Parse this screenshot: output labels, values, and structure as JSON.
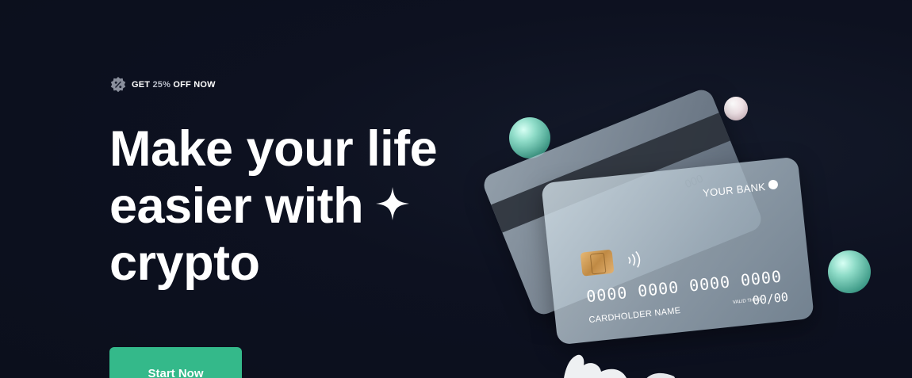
{
  "badge": {
    "icon": "percent-badge-icon",
    "prefix": "GET ",
    "percent": "25%",
    "suffix": " OFF NOW"
  },
  "hero": {
    "title_line1": "Make your life",
    "title_line2": "easier with",
    "title_line3": "crypto",
    "sparkle_icon": "sparkle-icon",
    "cta_label": "Start Now"
  },
  "card": {
    "bank_name": "YOUR BANK",
    "number": "0000 0000 0000 0000",
    "holder": "CARDHOLDER NAME",
    "valid_label": "VALID THRU",
    "expiry": "00/00",
    "back_ghost": "000"
  },
  "colors": {
    "background": "#0d1120",
    "accent": "#34b98a",
    "text": "#ffffff",
    "muted": "#b8bcc8"
  }
}
